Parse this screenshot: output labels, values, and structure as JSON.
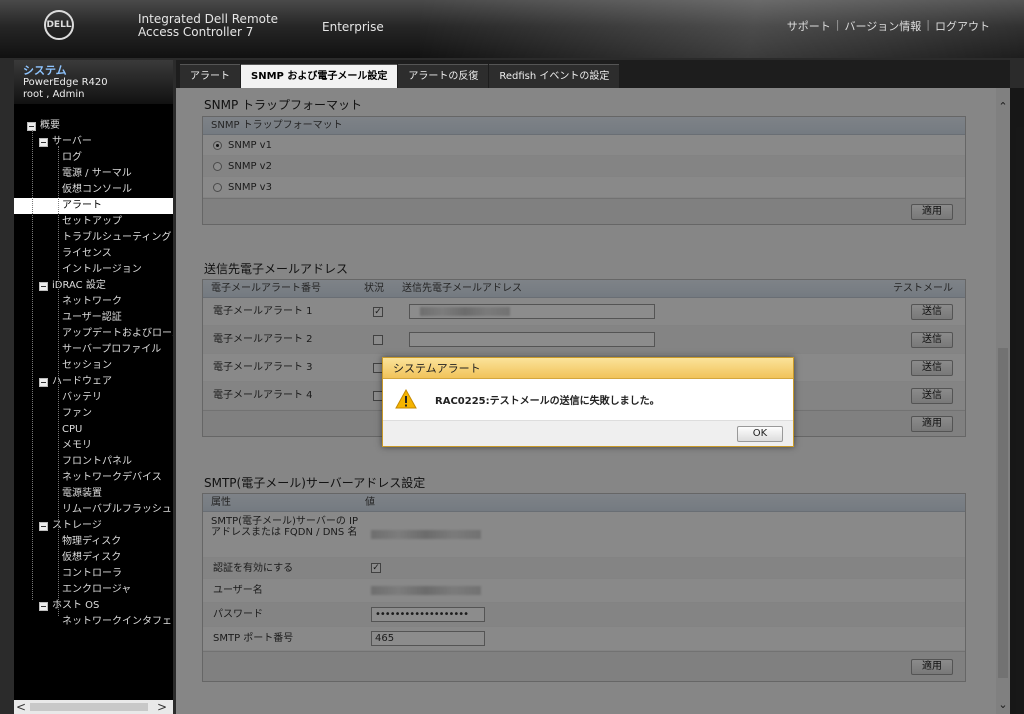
{
  "header": {
    "logo": "DELL",
    "product": "Integrated Dell Remote Access Controller 7",
    "edition": "Enterprise",
    "links": [
      "サポート",
      "バージョン情報",
      "ログアウト"
    ],
    "separator": "|"
  },
  "sidebar": {
    "title": "システム",
    "model": "PowerEdge R420",
    "user": "root , Admin",
    "tree": [
      {
        "label": "概要",
        "level": 0,
        "expander": true
      },
      {
        "label": "サーバー",
        "level": 1,
        "expander": true
      },
      {
        "label": "ログ",
        "level": 2
      },
      {
        "label": "電源 / サーマル",
        "level": 2
      },
      {
        "label": "仮想コンソール",
        "level": 2
      },
      {
        "label": "アラート",
        "level": 2,
        "selected": true
      },
      {
        "label": "セットアップ",
        "level": 2
      },
      {
        "label": "トラブルシューティング",
        "level": 2
      },
      {
        "label": "ライセンス",
        "level": 2
      },
      {
        "label": "イントルージョン",
        "level": 2
      },
      {
        "label": "iDRAC 設定",
        "level": 1,
        "expander": true
      },
      {
        "label": "ネットワーク",
        "level": 2
      },
      {
        "label": "ユーザー認証",
        "level": 2
      },
      {
        "label": "アップデートおよびロールバック",
        "level": 2
      },
      {
        "label": "サーバープロファイル",
        "level": 2
      },
      {
        "label": "セッション",
        "level": 2
      },
      {
        "label": "ハードウェア",
        "level": 1,
        "expander": true
      },
      {
        "label": "バッテリ",
        "level": 2
      },
      {
        "label": "ファン",
        "level": 2
      },
      {
        "label": "CPU",
        "level": 2
      },
      {
        "label": "メモリ",
        "level": 2
      },
      {
        "label": "フロントパネル",
        "level": 2
      },
      {
        "label": "ネットワークデバイス",
        "level": 2
      },
      {
        "label": "電源装置",
        "level": 2
      },
      {
        "label": "リムーバブルフラッシュメディア",
        "level": 2
      },
      {
        "label": "ストレージ",
        "level": 1,
        "expander": true
      },
      {
        "label": "物理ディスク",
        "level": 2
      },
      {
        "label": "仮想ディスク",
        "level": 2
      },
      {
        "label": "コントローラ",
        "level": 2
      },
      {
        "label": "エンクロージャ",
        "level": 2
      },
      {
        "label": "ホスト OS",
        "level": 1,
        "expander": true
      },
      {
        "label": "ネットワークインタフェース",
        "level": 2
      }
    ],
    "scroll_left": "<",
    "scroll_right": ">"
  },
  "tabs": [
    {
      "label": "アラート",
      "active": false
    },
    {
      "label": "SNMP および電子メール設定",
      "active": true
    },
    {
      "label": "アラートの反復",
      "active": false
    },
    {
      "label": "Redfish イベントの設定",
      "active": false
    }
  ],
  "snmp": {
    "section_title": "SNMP トラップフォーマット",
    "panel_header": "SNMP トラップフォーマット",
    "options": [
      {
        "label": "SNMP v1",
        "selected": true
      },
      {
        "label": "SNMP v2",
        "selected": false
      },
      {
        "label": "SNMP v3",
        "selected": false
      }
    ],
    "apply": "適用"
  },
  "email": {
    "section_title": "送信先電子メールアドレス",
    "columns": [
      "電子メールアラート番号",
      "状況",
      "送信先電子メールアドレス",
      "テストメール"
    ],
    "rows": [
      {
        "label": "電子メールアラート 1",
        "checked": true,
        "redacted": true
      },
      {
        "label": "電子メールアラート 2",
        "checked": false,
        "redacted": false
      },
      {
        "label": "電子メールアラート 3",
        "checked": false,
        "redacted": false
      },
      {
        "label": "電子メールアラート 4",
        "checked": false,
        "redacted": false
      }
    ],
    "send": "送信",
    "apply": "適用"
  },
  "smtp": {
    "section_title": "SMTP(電子メール)サーバーアドレス設定",
    "columns": [
      "属性",
      "値"
    ],
    "rows": {
      "address": "SMTP(電子メール)サーバーの IP アドレスまたは FQDN / DNS 名",
      "auth": "認証を有効にする",
      "user": "ユーザー名",
      "password": "パスワード",
      "port": "SMTP ポート番号"
    },
    "auth_checked": true,
    "password_value": "•••••••••••••••••••",
    "port_value": "465",
    "apply": "適用"
  },
  "dialog": {
    "title": "システムアラート",
    "message": "RAC0225:テストメールの送信に失敗しました。",
    "ok": "OK",
    "icon": "warning-icon"
  },
  "colors": {
    "accent_link": "#8ec4ff",
    "dialog_header": "#f1c35a"
  }
}
